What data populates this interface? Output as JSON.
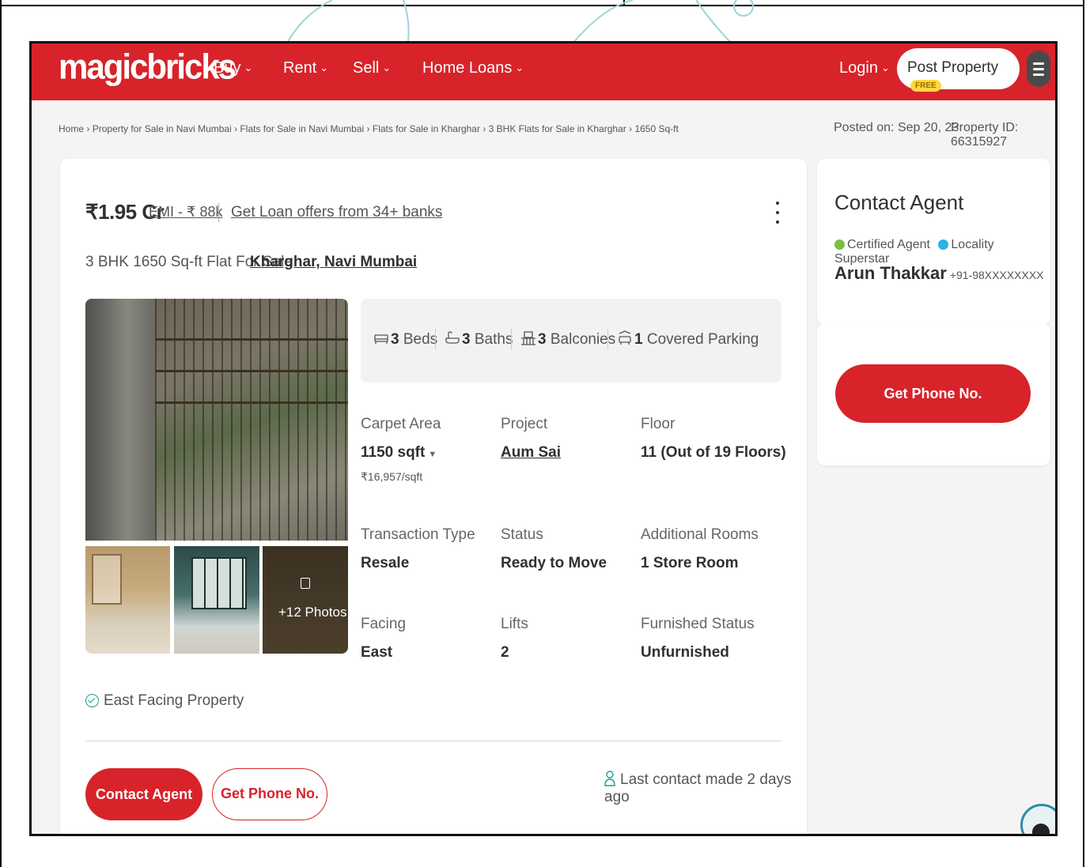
{
  "header": {
    "logo": "magicbricks",
    "nav": [
      "Buy",
      "Rent",
      "Sell",
      "Home Loans"
    ],
    "login_label": "Login",
    "post_property_label": "Post Property",
    "free_badge": "FREE",
    "menu_icon": "hamburger-menu-icon"
  },
  "breadcrumb": {
    "items": [
      "Home",
      "Property for Sale in Navi Mumbai",
      "Flats for Sale in Navi Mumbai",
      "Flats for Sale in Kharghar",
      "3 BHK Flats for Sale in Kharghar",
      "1650 Sq-ft"
    ],
    "separator": "›",
    "posted": "Posted on: Sep 20, 23",
    "property_id": "Property ID: 66315927"
  },
  "listing": {
    "price": "₹1.95 Cr",
    "emi": "EMI - ₹ 88k",
    "loan_offer": "Get Loan offers from 34+ banks",
    "title": "3 BHK 1650 Sq-ft Flat For Sale",
    "locality": "Kharghar, Navi Mumbai",
    "more_photos": "+12 Photos",
    "amenities": [
      {
        "value": "3",
        "label": "Beds",
        "icon": "bed-icon"
      },
      {
        "value": "3",
        "label": "Baths",
        "icon": "bathtub-icon"
      },
      {
        "value": "3",
        "label": "Balconies",
        "icon": "balcony-icon"
      },
      {
        "value": "1",
        "label": "Covered Parking",
        "icon": "car-icon"
      }
    ],
    "specs": {
      "carpet_area_label": "Carpet Area",
      "carpet_area_value": "1150 sqft",
      "carpet_area_rate": "₹16,957/sqft",
      "project_label": "Project",
      "project_value": "Aum Sai",
      "floor_label": "Floor",
      "floor_value": "11 (Out of 19 Floors)",
      "transaction_label": "Transaction Type",
      "transaction_value": "Resale",
      "status_label": "Status",
      "status_value": "Ready to Move",
      "rooms_label": "Additional Rooms",
      "rooms_value": "1 Store Room",
      "facing_label": "Facing",
      "facing_value": "East",
      "lifts_label": "Lifts",
      "lifts_value": "2",
      "furnished_label": "Furnished Status",
      "furnished_value": "Unfurnished"
    },
    "facing_note": "East Facing Property",
    "contact_button": "Contact Agent",
    "phone_button": "Get Phone No.",
    "last_contact": "Last contact made 2 days ago"
  },
  "agent": {
    "title": "Contact Agent",
    "badge_certified": "Certified Agent",
    "badge_locality": "Locality Superstar",
    "name": "Arun Thakkar",
    "phone": "+91-98XXXXXXXX",
    "phone_button": "Get Phone No."
  },
  "colors": {
    "brand": "#d8232a",
    "free_badge": "#ffd83c",
    "certified": "#7cc142",
    "superstar": "#2ab3e6"
  }
}
